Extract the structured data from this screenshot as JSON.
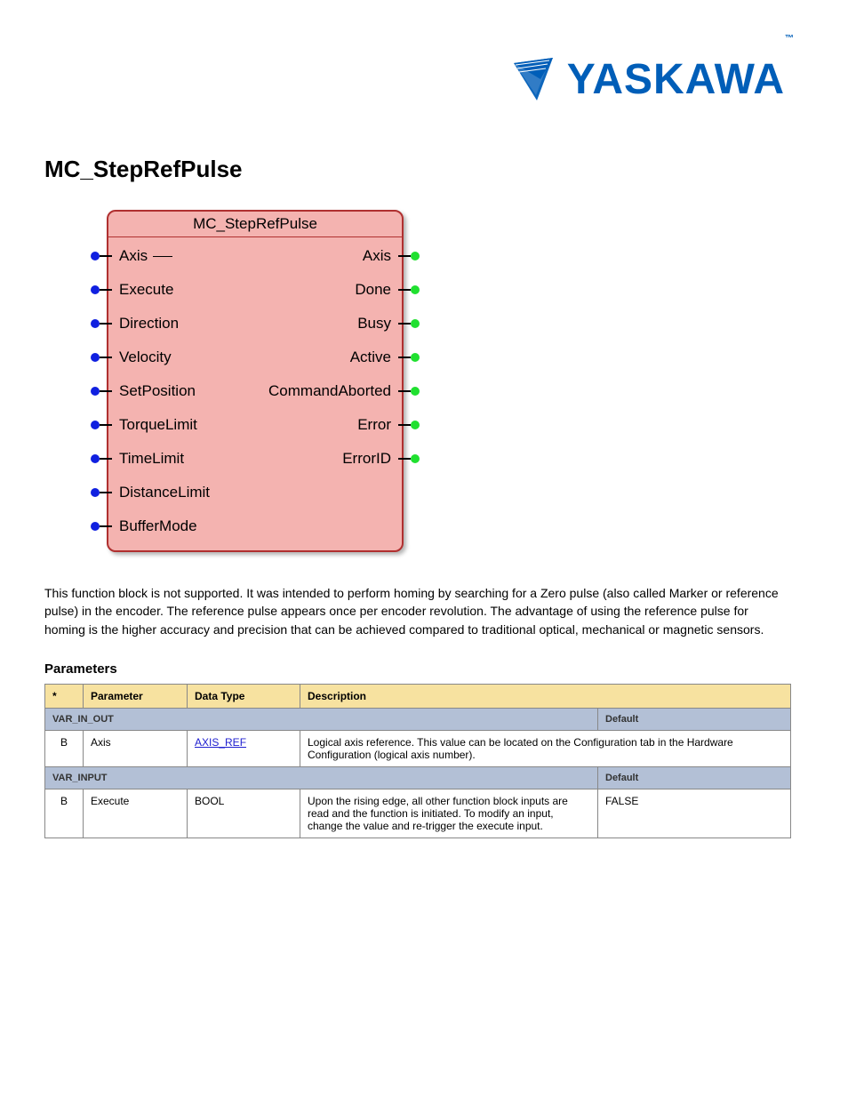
{
  "logo": {
    "text": "YASKAWA",
    "tm": "™"
  },
  "page_title": "MC_StepRefPulse",
  "fb": {
    "title": "MC_StepRefPulse",
    "inputs": [
      "Axis",
      "Execute",
      "Direction",
      "Velocity",
      "SetPosition",
      "TorqueLimit",
      "TimeLimit",
      "DistanceLimit",
      "BufferMode"
    ],
    "outputs": [
      "Axis",
      "Done",
      "Busy",
      "Active",
      "CommandAborted",
      "Error",
      "ErrorID"
    ]
  },
  "description": "This function block is not supported. It was intended to perform homing by searching for a Zero pulse (also called Marker or reference pulse) in the encoder. The reference pulse appears once per encoder revolution. The advantage of using the reference pulse for homing is the higher accuracy and precision that can be achieved compared to traditional optical, mechanical or magnetic sensors.",
  "params_header": "Parameters",
  "table": {
    "hdr": {
      "c1": "*",
      "c2": "Parameter",
      "c3": "Data Type",
      "c4": "Description"
    },
    "grp1": {
      "label": "VAR_IN_OUT",
      "default": "Default"
    },
    "axis_row": {
      "c1": "B",
      "c2": "Axis",
      "c3": "AXIS_REF",
      "c4": "Logical axis reference. This value can be located on the Configuration tab in the Hardware Configuration (logical axis number)."
    },
    "grp2": {
      "label": "VAR_INPUT",
      "default": "Default"
    },
    "exec_row": {
      "c1": "B",
      "c2": "Execute",
      "c3": "BOOL",
      "c4": "Upon the rising edge, all other function block inputs are read and the function is initiated. To modify an input, change the value and re-trigger the execute input.",
      "c5": "FALSE"
    }
  }
}
